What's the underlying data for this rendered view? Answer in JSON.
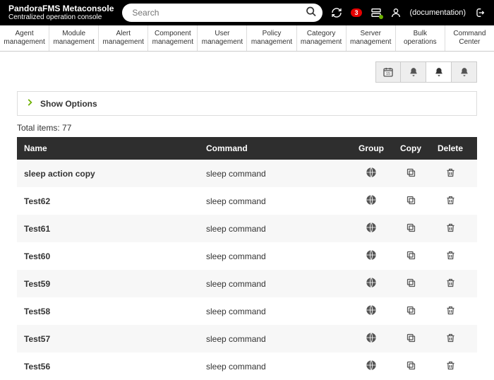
{
  "header": {
    "brand_title": "PandoraFMS Metaconsole",
    "brand_subtitle": "Centralized operation console",
    "search_placeholder": "Search",
    "notify_count": "3",
    "doc_label": "(documentation)"
  },
  "nav": [
    {
      "l1": "Agent",
      "l2": "management"
    },
    {
      "l1": "Module",
      "l2": "management"
    },
    {
      "l1": "Alert",
      "l2": "management"
    },
    {
      "l1": "Component",
      "l2": "management"
    },
    {
      "l1": "User",
      "l2": "management"
    },
    {
      "l1": "Policy",
      "l2": "management"
    },
    {
      "l1": "Category",
      "l2": "management"
    },
    {
      "l1": "Server",
      "l2": "management"
    },
    {
      "l1": "Bulk",
      "l2": "operations"
    },
    {
      "l1": "Command",
      "l2": "Center"
    }
  ],
  "show_options_label": "Show Options",
  "total_items_label": "Total items: 77",
  "columns": {
    "name": "Name",
    "command": "Command",
    "group": "Group",
    "copy": "Copy",
    "delete": "Delete"
  },
  "rows": [
    {
      "name": "sleep action copy",
      "command": "sleep command"
    },
    {
      "name": "Test62",
      "command": "sleep command"
    },
    {
      "name": "Test61",
      "command": "sleep command"
    },
    {
      "name": "Test60",
      "command": "sleep command"
    },
    {
      "name": "Test59",
      "command": "sleep command"
    },
    {
      "name": "Test58",
      "command": "sleep command"
    },
    {
      "name": "Test57",
      "command": "sleep command"
    },
    {
      "name": "Test56",
      "command": "sleep command"
    }
  ]
}
